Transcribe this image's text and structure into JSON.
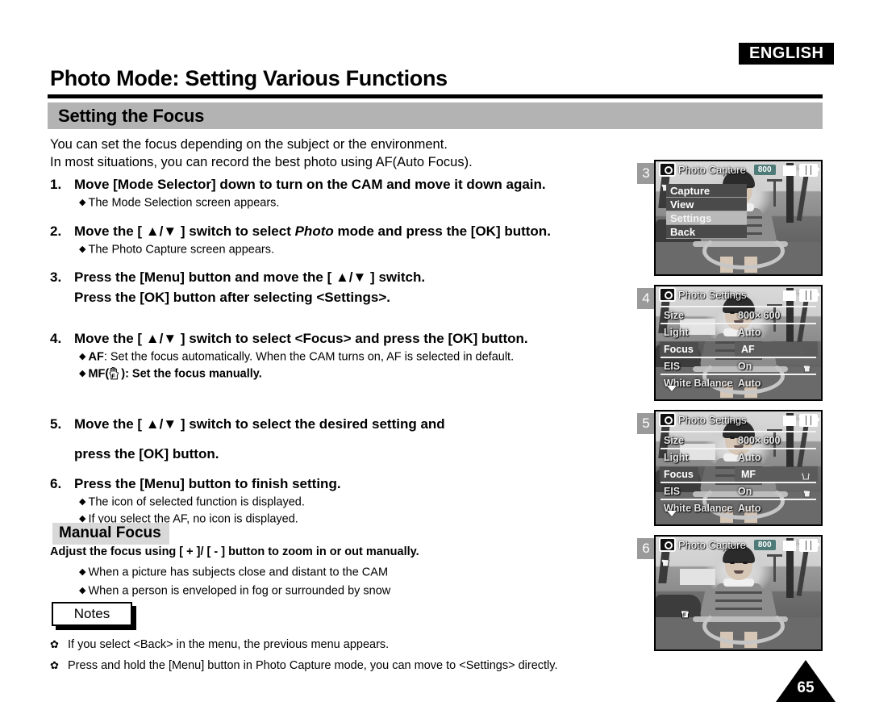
{
  "header": {
    "language_badge": "ENGLISH",
    "page_title": "Photo Mode: Setting Various Functions",
    "section_title": "Setting the Focus"
  },
  "intro": {
    "line1": "You can set the focus depending on the subject or the environment.",
    "line2": "In most situations, you can record the best photo using AF(Auto Focus)."
  },
  "steps": [
    {
      "num": "1.",
      "text": "Move [Mode Selector] down to turn on the CAM and move it down again.",
      "subs": [
        "The Mode Selection screen appears."
      ]
    },
    {
      "num": "2.",
      "text_before": "Move the [ ▲/▼ ] switch to select ",
      "italic": "Photo",
      "text_after": " mode and press the [OK] button.",
      "subs": [
        "The Photo Capture screen appears."
      ]
    },
    {
      "num": "3.",
      "text": "Press the [Menu] button and move the [ ▲/▼ ] switch.",
      "line2": "Press the [OK] button after selecting <Settings>.",
      "subs": []
    },
    {
      "num": "4.",
      "text": "Move the [ ▲/▼ ] switch to select <Focus> and press the [OK] button.",
      "sub_af_label": "AF",
      "sub_af_text": ": Set the focus automatically. When the CAM turns on, AF is selected in default.",
      "sub_mf_label": "MF",
      "sub_mf_text": "): Set the focus manually."
    },
    {
      "num": "5.",
      "text": "Move the [ ▲/▼ ] switch to select the desired setting and",
      "line2": "press the [OK] button.",
      "subs": []
    },
    {
      "num": "6.",
      "text": "Press the [Menu] button to finish setting.",
      "subs": [
        "The icon of selected function is displayed.",
        "If you select the AF, no icon is displayed."
      ]
    }
  ],
  "manual_focus": {
    "heading": "Manual Focus",
    "lead": "Adjust the focus using [ + ]/ [ - ] button to zoom in or out manually.",
    "bullets": [
      "When a picture has subjects close and distant to the CAM",
      "When a person is enveloped in fog or surrounded by snow"
    ]
  },
  "notes": {
    "label": "Notes",
    "items": [
      "If you select <Back> in the menu, the previous menu appears.",
      "Press and hold the [Menu] button in Photo Capture mode, you can move to <Settings> directly."
    ]
  },
  "screens": [
    {
      "badge": "3",
      "title": "Photo Capture",
      "size_badge": "800",
      "menu": [
        {
          "label": "Capture",
          "selected": false
        },
        {
          "label": "View",
          "selected": false
        },
        {
          "label": "Settings",
          "selected": true
        },
        {
          "label": "Back",
          "selected": false
        }
      ]
    },
    {
      "badge": "4",
      "title": "Photo Settings",
      "rows": [
        {
          "label": "Size",
          "value": "800× 600",
          "selected": false
        },
        {
          "label": "Light",
          "value": "Auto",
          "selected": false
        },
        {
          "label": "Focus",
          "value": "AF",
          "selected": true
        },
        {
          "label": "EIS",
          "value": "On",
          "selected": false
        },
        {
          "label": "White Balance",
          "value": "Auto",
          "selected": false
        }
      ]
    },
    {
      "badge": "5",
      "title": "Photo Settings",
      "rows": [
        {
          "label": "Size",
          "value": "800× 600",
          "selected": false
        },
        {
          "label": "Light",
          "value": "Auto",
          "selected": false
        },
        {
          "label": "Focus",
          "value": "MF",
          "selected": true
        },
        {
          "label": "EIS",
          "value": "On",
          "selected": false
        },
        {
          "label": "White Balance",
          "value": "Auto",
          "selected": false
        }
      ]
    },
    {
      "badge": "6",
      "title": "Photo Capture",
      "size_badge": "800"
    }
  ],
  "page_number": "65",
  "colors": {
    "section_bar": "#b3b3b3",
    "manual_focus_bg": "#d8d8d8",
    "step_badge": "#9a9a9a",
    "size_badge": "#4e7a78"
  }
}
